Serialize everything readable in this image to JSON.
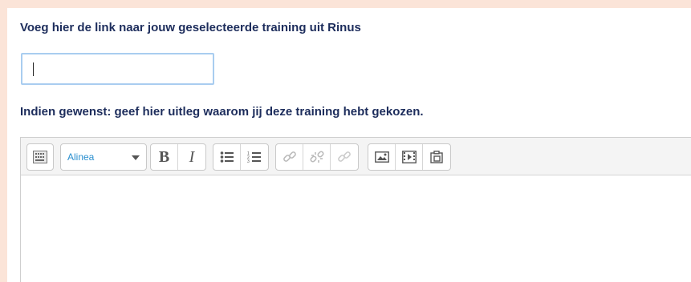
{
  "form": {
    "link_question": "Voeg hier de link naar jouw geselecteerde training uit Rinus",
    "link_value": "",
    "explanation_question": "Indien gewenst: geef hier uitleg waarom jij deze training hebt gekozen."
  },
  "editor": {
    "paragraph_select": {
      "selected": "Alinea"
    },
    "toolbar_icons": [
      "toolbar-toggle-icon",
      "bold-icon",
      "italic-icon",
      "unordered-list-icon",
      "ordered-list-icon",
      "link-icon",
      "unlink-icon",
      "anchor-link-icon",
      "image-icon",
      "media-icon",
      "manage-files-icon"
    ],
    "bold_glyph": "B",
    "italic_glyph": "I",
    "content": ""
  },
  "colors": {
    "page_background": "#fbe4d8",
    "heading_text": "#1d2d5c",
    "input_focus_border": "#a9cdf0",
    "select_text": "#2a8fcf"
  }
}
